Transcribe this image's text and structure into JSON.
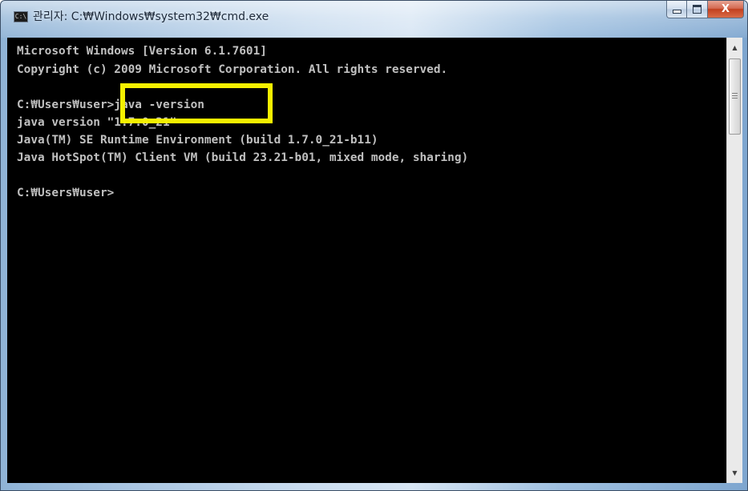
{
  "window": {
    "title": "관리자: C:₩Windows₩system32₩cmd.exe",
    "icon": "cmd-icon",
    "icon_label": "C:\\",
    "buttons": {
      "minimize": "minimize-icon",
      "maximize": "maximize-icon",
      "close": "close-icon",
      "close_glyph": "X"
    }
  },
  "console": {
    "background": "#000000",
    "text_color": "#c0c0c0",
    "lines": [
      "Microsoft Windows [Version 6.1.7601]",
      "Copyright (c) 2009 Microsoft Corporation. All rights reserved.",
      "",
      "C:₩Users₩user>java -version",
      "java version \"1.7.0_21\"",
      "Java(TM) SE Runtime Environment (build 1.7.0_21-b11)",
      "Java HotSpot(TM) Client VM (build 23.21-b01, mixed mode, sharing)",
      "",
      "C:₩Users₩user>"
    ]
  },
  "scrollbar": {
    "up_arrow": "▲",
    "down_arrow": "▼"
  },
  "annotation": {
    "color": "#f5f000"
  }
}
